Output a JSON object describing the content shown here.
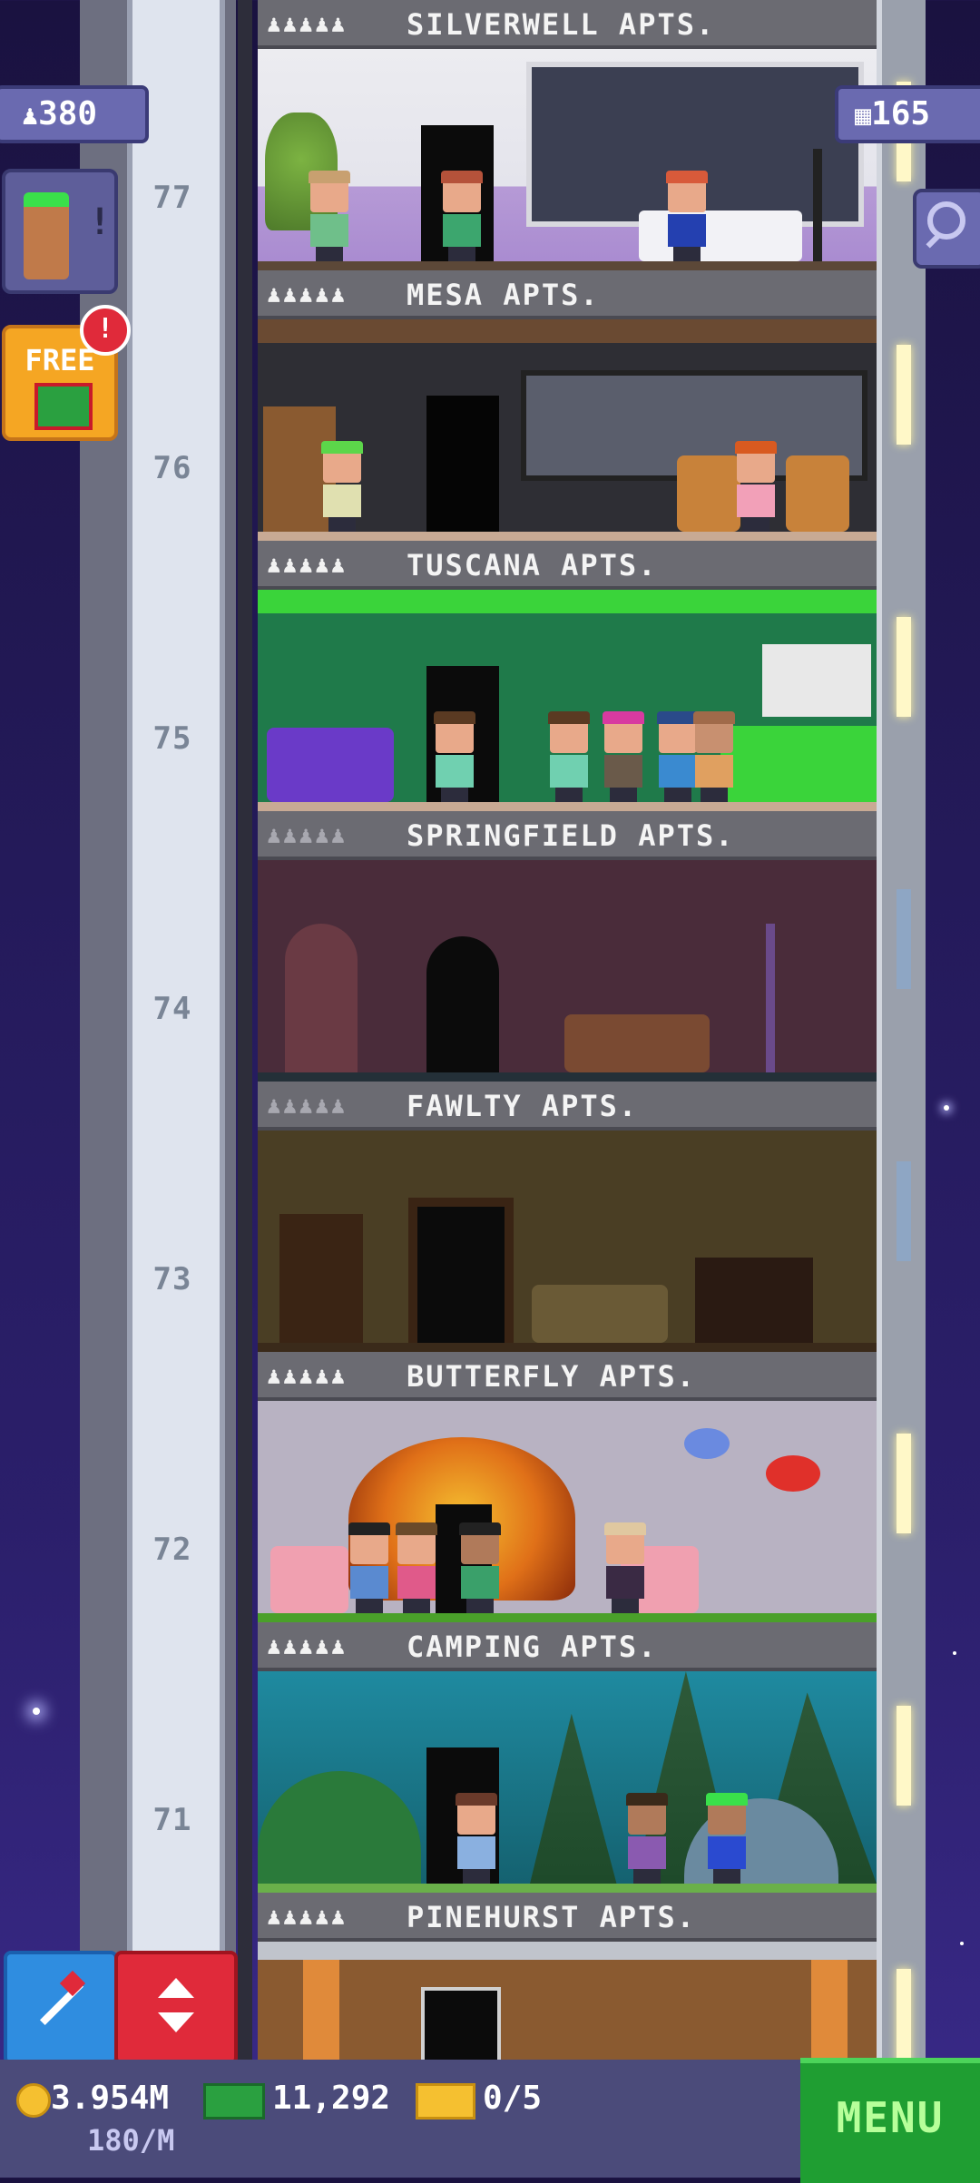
{
  "hud": {
    "population": "380",
    "floors": "165",
    "free_label": "FREE",
    "free_alert": "!",
    "bitizen_alert": "!"
  },
  "floors": [
    {
      "number": "77",
      "name": "SILVERWELL APTS.",
      "people": "♟♟♟♟♟"
    },
    {
      "number": "76",
      "name": "MESA APTS.",
      "people": "♟♟♟♟♟"
    },
    {
      "number": "75",
      "name": "TUSCANA APTS.",
      "people": "♟♟♟♟♟"
    },
    {
      "number": "74",
      "name": "SPRINGFIELD APTS.",
      "people": "♟♟♟♟♟"
    },
    {
      "number": "73",
      "name": "FAWLTY APTS.",
      "people": "♟♟♟♟♟"
    },
    {
      "number": "72",
      "name": "BUTTERFLY APTS.",
      "people": "♟♟♟♟♟"
    },
    {
      "number": "71",
      "name": "CAMPING APTS.",
      "people": "♟♟♟♟♟"
    },
    {
      "number": "",
      "name": "PINEHURST APTS.",
      "people": "♟♟♟♟♟"
    }
  ],
  "status": {
    "coins": "3.954M",
    "coin_rate": "180/M",
    "bux": "11,292",
    "tickets": "0/5"
  },
  "menu_label": "MENU",
  "colors": {
    "menu_green": "#1f9e32",
    "bar_purple": "#4b4b7a",
    "free_orange": "#f5a623",
    "elevator_red": "#e02a3a",
    "elevator_blue": "#2f8de0"
  }
}
